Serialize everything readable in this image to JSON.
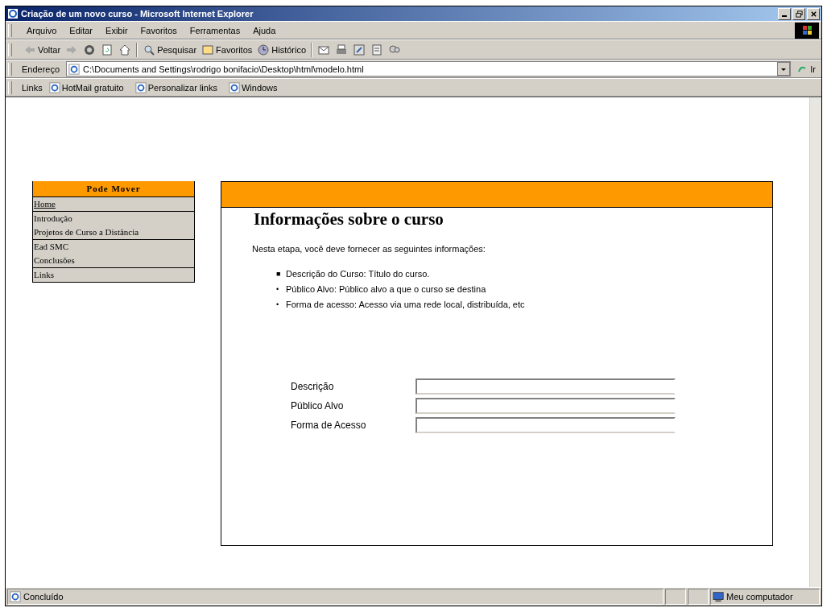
{
  "window": {
    "title": "Criação de um novo curso - Microsoft Internet Explorer"
  },
  "menu": [
    "Arquivo",
    "Editar",
    "Exibir",
    "Favoritos",
    "Ferramentas",
    "Ajuda"
  ],
  "toolbar": [
    {
      "kind": "back",
      "label": "Voltar"
    },
    {
      "kind": "forward"
    },
    {
      "kind": "stop"
    },
    {
      "kind": "refresh"
    },
    {
      "kind": "home"
    },
    {
      "kind": "sep"
    },
    {
      "kind": "search",
      "label": "Pesquisar"
    },
    {
      "kind": "favorites",
      "label": "Favoritos"
    },
    {
      "kind": "history",
      "label": "Histórico"
    },
    {
      "kind": "sep"
    },
    {
      "kind": "mail"
    },
    {
      "kind": "print"
    },
    {
      "kind": "edit"
    },
    {
      "kind": "notes"
    },
    {
      "kind": "messenger"
    }
  ],
  "address": {
    "label": "Endereço",
    "value": "C:\\Documents and Settings\\rodrigo bonifacio\\Desktop\\html\\modelo.html",
    "go": "Ir"
  },
  "links_bar": {
    "label": "Links",
    "items": [
      "HotMail gratuito",
      "Personalizar links",
      "Windows"
    ]
  },
  "sidebar": {
    "title": "Pode Mover",
    "groups": [
      [
        {
          "label": "Home",
          "underlined": true
        }
      ],
      [
        {
          "label": "Introdução",
          "underlined": false
        },
        {
          "label": "Projetos de Curso a Distância",
          "underlined": false
        }
      ],
      [
        {
          "label": "Ead SMC",
          "underlined": false
        },
        {
          "label": "Conclusões",
          "underlined": false
        }
      ],
      [
        {
          "label": "Links",
          "underlined": false
        }
      ]
    ]
  },
  "content": {
    "heading": "Informações sobre o curso",
    "intro": "Nesta etapa, você deve fornecer as seguintes informações:",
    "bullets": [
      {
        "marker": "■",
        "text": "Descrição do Curso: Título do curso."
      },
      {
        "marker": "•",
        "text": "Público Alvo: Público alvo a que o curso se destina"
      },
      {
        "marker": "•",
        "text": "Forma de acesso: Acesso via uma rede local, distribuída, etc"
      }
    ],
    "fields": [
      {
        "label": "Descrição"
      },
      {
        "label": "Público Alvo"
      },
      {
        "label": "Forma de Acesso"
      }
    ]
  },
  "status_bar": {
    "text": "Concluído",
    "zone": "Meu computador"
  }
}
